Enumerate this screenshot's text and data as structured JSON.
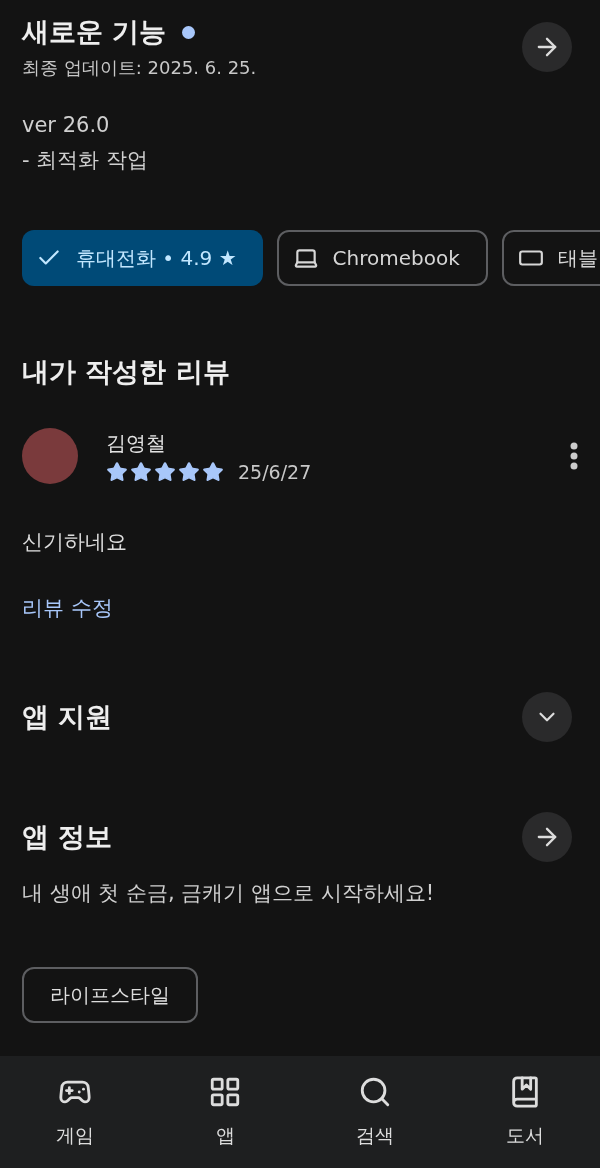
{
  "whats_new": {
    "title": "새로운 기능",
    "new_dot": true,
    "updated": "최종 업데이트: 2025. 6. 25.",
    "notes": [
      "ver 26.0",
      "- 최적화 작업"
    ]
  },
  "devices": [
    {
      "kind": "phone",
      "label": "휴대전화 • 4.9 ★",
      "selected": true
    },
    {
      "kind": "laptop",
      "label": "Chromebook",
      "selected": false
    },
    {
      "kind": "tablet",
      "label": "태블",
      "selected": false
    }
  ],
  "my_review": {
    "heading": "내가 작성한 리뷰",
    "author": "김영철",
    "stars": 5,
    "date": "25/6/27",
    "text": "신기하네요",
    "edit_link": "리뷰 수정"
  },
  "app_support": {
    "title": "앱 지원",
    "expanded": false
  },
  "app_info": {
    "title": "앱 정보",
    "description": "내 생애 첫 순금, 금캐기 앱으로 시작하세요!",
    "category": "라이프스타일"
  },
  "bottom_nav": [
    {
      "kind": "games",
      "label": "게임",
      "selected": false
    },
    {
      "kind": "apps",
      "label": "앱",
      "selected": false
    },
    {
      "kind": "search",
      "label": "검색",
      "selected": false
    },
    {
      "kind": "books",
      "label": "도서",
      "selected": false
    }
  ]
}
